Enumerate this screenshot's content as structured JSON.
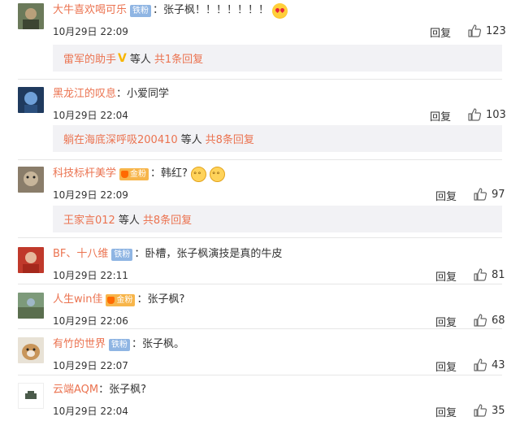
{
  "comments": [
    {
      "user": "大牛喜欢喝可乐",
      "badge": "铁粉",
      "text": "：张子枫！！！！！！！",
      "time": "10月29日 22:09",
      "reply_label": "回复",
      "likes": "123",
      "emoji": [
        "heart-eyes-icon"
      ],
      "replies": {
        "who": "雷军的助手",
        "mid": "等人",
        "count": "共1条回复"
      }
    },
    {
      "user": "黑龙江的叹息",
      "text": "：小爱同学",
      "time": "10月29日 22:04",
      "reply_label": "回复",
      "likes": "103",
      "replies": {
        "who": "躺在海底深呼吸200410",
        "mid": "等人",
        "count": "共8条回复"
      }
    },
    {
      "user": "科技标杆美学",
      "badge": "金粉",
      "text": "：韩红?",
      "time": "10月29日 22:09",
      "reply_label": "回复",
      "likes": "97",
      "emoji": [
        "cat-icon",
        "cat-icon"
      ],
      "replies": {
        "who": "王家言012",
        "mid": "等人",
        "count": "共8条回复"
      }
    },
    {
      "user": "BF、十八维",
      "badge": "铁粉",
      "text": "：卧槽，张子枫演技是真的牛皮",
      "time": "10月29日 22:11",
      "reply_label": "回复",
      "likes": "81"
    },
    {
      "user": "人生win佳",
      "badge": "金粉",
      "text": "：张子枫?",
      "time": "10月29日 22:06",
      "reply_label": "回复",
      "likes": "68"
    },
    {
      "user": "有竹的世界",
      "badge": "铁粉",
      "text": "：张子枫。",
      "time": "10月29日 22:07",
      "reply_label": "回复",
      "likes": "43"
    },
    {
      "user": "云端AQM",
      "text": "：张子枫?",
      "time": "10月29日 22:04",
      "reply_label": "回复",
      "likes": "35"
    }
  ],
  "colors": {
    "username": "#eb7350",
    "badge_iron": "#8fb5e3",
    "badge_gold": "#f7b54a",
    "reply_box_bg": "#f2f2f5"
  }
}
